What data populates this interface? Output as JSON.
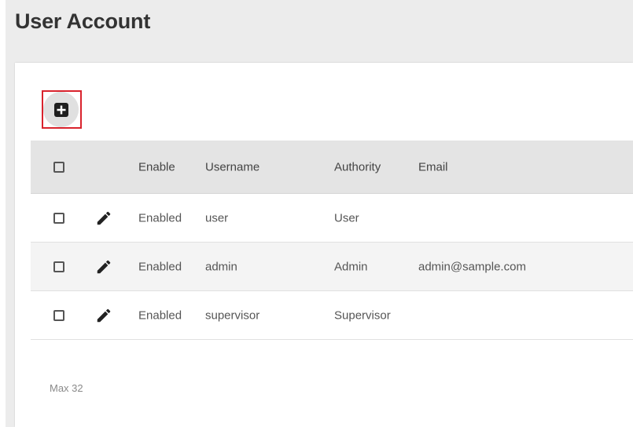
{
  "page": {
    "title": "User Account"
  },
  "toolbar": {
    "add_icon": "add-box-icon"
  },
  "table": {
    "columns": {
      "enable": "Enable",
      "username": "Username",
      "authority": "Authority",
      "email": "Email"
    },
    "rows": [
      {
        "enable": "Enabled",
        "username": "user",
        "authority": "User",
        "email": ""
      },
      {
        "enable": "Enabled",
        "username": "admin",
        "authority": "Admin",
        "email": "admin@sample.com"
      },
      {
        "enable": "Enabled",
        "username": "supervisor",
        "authority": "Supervisor",
        "email": ""
      }
    ]
  },
  "footer": {
    "max_note": "Max 32"
  },
  "colors": {
    "highlight_border": "#d9232d",
    "header_bg": "#e4e4e4",
    "alt_row_bg": "#f4f4f4"
  }
}
